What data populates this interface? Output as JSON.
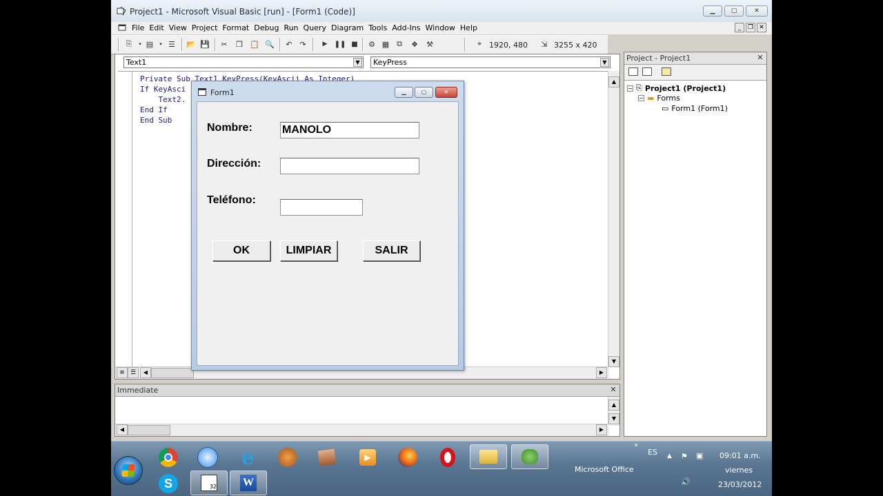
{
  "window": {
    "title": "Project1 - Microsoft Visual Basic [run] - [Form1 (Code)]",
    "min": "▭",
    "max": "▢",
    "close": "✕"
  },
  "menu": {
    "items": [
      "File",
      "Edit",
      "View",
      "Project",
      "Format",
      "Debug",
      "Run",
      "Query",
      "Diagram",
      "Tools",
      "Add-Ins",
      "Window",
      "Help"
    ]
  },
  "toolbar": {
    "position": "1920, 480",
    "size": "3255 x 420"
  },
  "code": {
    "object_combo": "Text1",
    "procedure_combo": "KeyPress",
    "lines": [
      "Private Sub Text1_KeyPress(KeyAscii As Integer)",
      "If KeyAsci",
      "    Text2.",
      "End If",
      "End Sub"
    ]
  },
  "immediate": {
    "title": "Immediate"
  },
  "project": {
    "title": "Project - Project1",
    "root": "Project1 (Project1)",
    "folder": "Forms",
    "form": "Form1 (Form1)"
  },
  "form1": {
    "title": "Form1",
    "labels": {
      "nombre": "Nombre:",
      "direccion": "Dirección:",
      "telefono": "Teléfono:"
    },
    "values": {
      "nombre": "MANOLO",
      "direccion": "",
      "telefono": ""
    },
    "buttons": {
      "ok": "OK",
      "limpiar": "LIMPIAR",
      "salir": "SALIR"
    }
  },
  "taskbar": {
    "office_label": "Microsoft Office",
    "lang": "ES",
    "time": "09:01 a.m.",
    "day": "viernes",
    "date": "23/03/2012"
  },
  "colors": {
    "accent": "#5a7692",
    "form_border": "#6b88aa",
    "close_red": "#c8443a"
  }
}
